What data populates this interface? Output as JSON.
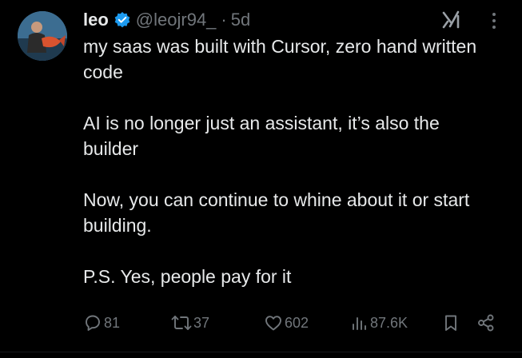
{
  "tweet": {
    "author_name": "leo",
    "handle": "@leojr94_",
    "separator": "·",
    "time": "5d",
    "paragraphs": [
      "my saas was built with Cursor, zero hand written code",
      "AI is no longer just an assistant, it’s also the builder",
      "Now, you can continue to whine about it or start building.",
      "P.S. Yes, people pay for it"
    ]
  },
  "actions": {
    "replies": "81",
    "reposts": "37",
    "likes": "602",
    "views": "87.6K"
  },
  "icons": {
    "verified": "verified-badge-icon",
    "grok": "grok-icon",
    "more": "more-icon",
    "reply": "reply-icon",
    "repost": "repost-icon",
    "like": "heart-icon",
    "views": "views-icon",
    "bookmark": "bookmark-icon",
    "share": "share-icon"
  },
  "colors": {
    "background": "#000000",
    "text": "#e7e9ea",
    "secondary": "#71767b",
    "verified": "#1d9bf0"
  }
}
